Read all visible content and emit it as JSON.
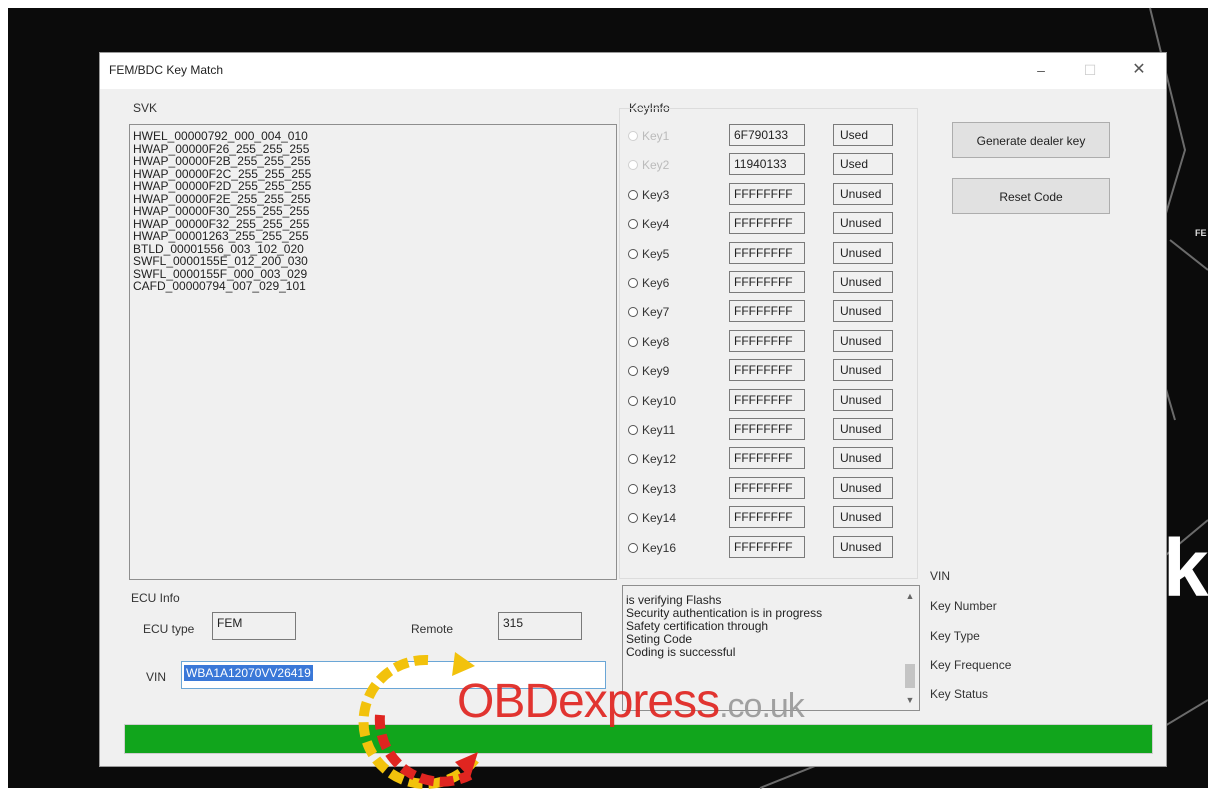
{
  "window": {
    "title": "FEM/BDC Key Match",
    "min_glyph": "–",
    "max_glyph": "☐",
    "close_glyph": "✕"
  },
  "svk": {
    "label": "SVK",
    "items": [
      "HWEL_00000792_000_004_010",
      "HWAP_00000F26_255_255_255",
      "HWAP_00000F2B_255_255_255",
      "HWAP_00000F2C_255_255_255",
      "HWAP_00000F2D_255_255_255",
      "HWAP_00000F2E_255_255_255",
      "HWAP_00000F30_255_255_255",
      "HWAP_00000F32_255_255_255",
      "HWAP_00001263_255_255_255",
      "BTLD_00001556_003_102_020",
      "SWFL_0000155E_012_200_030",
      "SWFL_0000155F_000_003_029",
      "CAFD_00000794_007_029_101"
    ]
  },
  "keyinfo": {
    "label": "KeyInfo",
    "keys": [
      {
        "label": "Key1",
        "code": "6F790133",
        "status": "Used",
        "enabled": false
      },
      {
        "label": "Key2",
        "code": "11940133",
        "status": "Used",
        "enabled": false
      },
      {
        "label": "Key3",
        "code": "FFFFFFFF",
        "status": "Unused",
        "enabled": true
      },
      {
        "label": "Key4",
        "code": "FFFFFFFF",
        "status": "Unused",
        "enabled": true
      },
      {
        "label": "Key5",
        "code": "FFFFFFFF",
        "status": "Unused",
        "enabled": true
      },
      {
        "label": "Key6",
        "code": "FFFFFFFF",
        "status": "Unused",
        "enabled": true
      },
      {
        "label": "Key7",
        "code": "FFFFFFFF",
        "status": "Unused",
        "enabled": true
      },
      {
        "label": "Key8",
        "code": "FFFFFFFF",
        "status": "Unused",
        "enabled": true
      },
      {
        "label": "Key9",
        "code": "FFFFFFFF",
        "status": "Unused",
        "enabled": true
      },
      {
        "label": "Key10",
        "code": "FFFFFFFF",
        "status": "Unused",
        "enabled": true
      },
      {
        "label": "Key11",
        "code": "FFFFFFFF",
        "status": "Unused",
        "enabled": true
      },
      {
        "label": "Key12",
        "code": "FFFFFFFF",
        "status": "Unused",
        "enabled": true
      },
      {
        "label": "Key13",
        "code": "FFFFFFFF",
        "status": "Unused",
        "enabled": true
      },
      {
        "label": "Key14",
        "code": "FFFFFFFF",
        "status": "Unused",
        "enabled": true
      },
      {
        "label": "Key16",
        "code": "FFFFFFFF",
        "status": "Unused",
        "enabled": true
      }
    ]
  },
  "buttons": {
    "generate": "Generate dealer key",
    "reset": "Reset Code"
  },
  "ecu": {
    "label": "ECU Info",
    "type_label": "ECU type",
    "type_value": "FEM",
    "remote_label": "Remote",
    "remote_value": "315",
    "vin_label": "VIN",
    "vin_value": "WBA1A12070VV26419"
  },
  "log": {
    "lines": [
      "is verifying Flashs",
      "Security authentication is in progress",
      "Safety certification through",
      "Seting Code",
      "Coding is successful"
    ],
    "up_glyph": "▲",
    "down_glyph": "▼"
  },
  "info_labels": {
    "vin": "VIN",
    "key_number": "Key Number",
    "key_type": "Key Type",
    "key_frequence": "Key Frequence",
    "key_status": "Key Status"
  },
  "progress": {
    "value": 1.0,
    "color": "#11a51c"
  },
  "watermark": {
    "brand": "OBDexpress",
    "suffix": ".co.uk"
  },
  "background": {
    "partial_text": "k",
    "corner_text": "FE"
  }
}
